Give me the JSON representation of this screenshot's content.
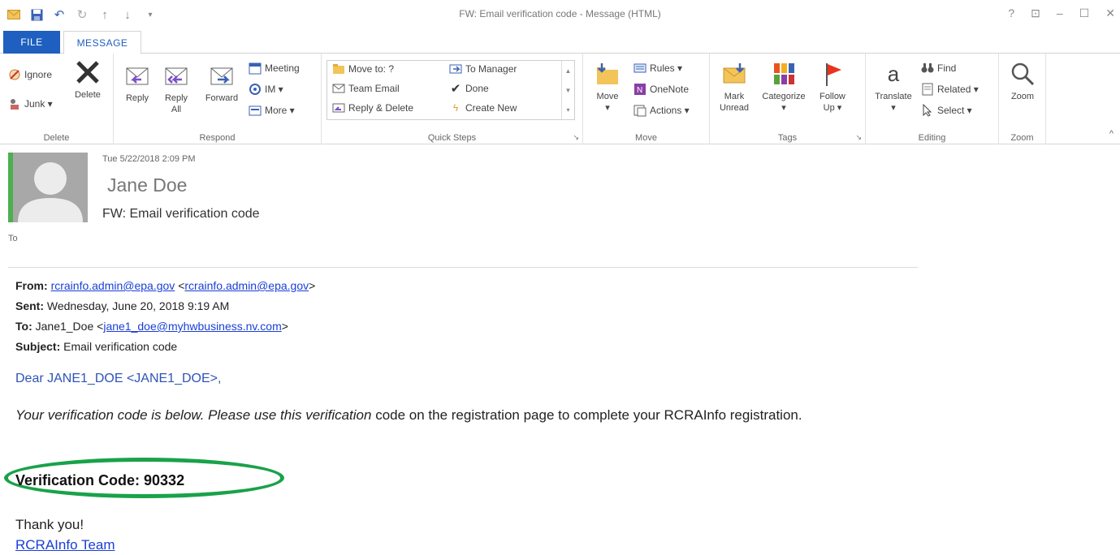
{
  "window": {
    "title": "FW: Email verification code - Message (HTML)",
    "controls": [
      "?",
      "⊡",
      "–",
      "☐",
      "✕"
    ]
  },
  "tabs": {
    "file": "FILE",
    "message": "MESSAGE"
  },
  "ribbon": {
    "delete_group": {
      "label": "Delete",
      "ignore": "Ignore",
      "junk": "Junk ▾",
      "delete": "Delete"
    },
    "respond_group": {
      "label": "Respond",
      "reply": "Reply",
      "reply_all_1": "Reply",
      "reply_all_2": "All",
      "forward": "Forward",
      "meeting": "Meeting",
      "im": "IM ▾",
      "more": "More ▾"
    },
    "quick_steps": {
      "label": "Quick Steps",
      "move_to": "Move to: ?",
      "team_email": "Team Email",
      "reply_delete": "Reply & Delete",
      "to_manager": "To Manager",
      "done": "Done",
      "create_new": "Create New"
    },
    "move_group": {
      "label": "Move",
      "move": "Move",
      "rules": "Rules ▾",
      "onenote": "OneNote",
      "actions": "Actions ▾"
    },
    "tags_group": {
      "label": "Tags",
      "mark_unread_1": "Mark",
      "mark_unread_2": "Unread",
      "categorize": "Categorize",
      "follow_up_1": "Follow",
      "follow_up_2": "Up ▾"
    },
    "editing_group": {
      "label": "Editing",
      "translate": "Translate",
      "find": "Find",
      "related": "Related ▾",
      "select": "Select ▾"
    },
    "zoom_group": {
      "label": "Zoom",
      "zoom": "Zoom"
    }
  },
  "message": {
    "date": "Tue 5/22/2018 2:09 PM",
    "sender": "Jane Doe",
    "subject": "FW: Email verification code",
    "to_label": "To"
  },
  "forward_header": {
    "from_label": "From:",
    "from_email": "rcrainfo.admin@epa.gov",
    "from_email_bracket": "rcrainfo.admin@epa.gov",
    "sent_label": "Sent:",
    "sent_value": "Wednesday, June 20, 2018 9:19 AM",
    "to_label": "To:",
    "to_name": "Jane1_Doe",
    "to_email": "jane1_doe@myhwbusiness.nv.com",
    "subject_label": "Subject:",
    "subject_value": "Email verification code"
  },
  "body": {
    "greeting": "Dear JANE1_DOE <JANE1_DOE>,",
    "para_part1": "Your verification code is below. Please use this verification",
    "para_part2": " code on the registration page to complete your RCRAInfo registration.",
    "verification_code": "Verification Code: 90332",
    "thanks": "Thank you!",
    "team": "RCRAInfo Team"
  },
  "colors": {
    "file_tab": "#1e5fbf",
    "highlight_ellipse": "#19a24a",
    "link": "#1a3fd6",
    "unread_bar": "#4caf50"
  }
}
